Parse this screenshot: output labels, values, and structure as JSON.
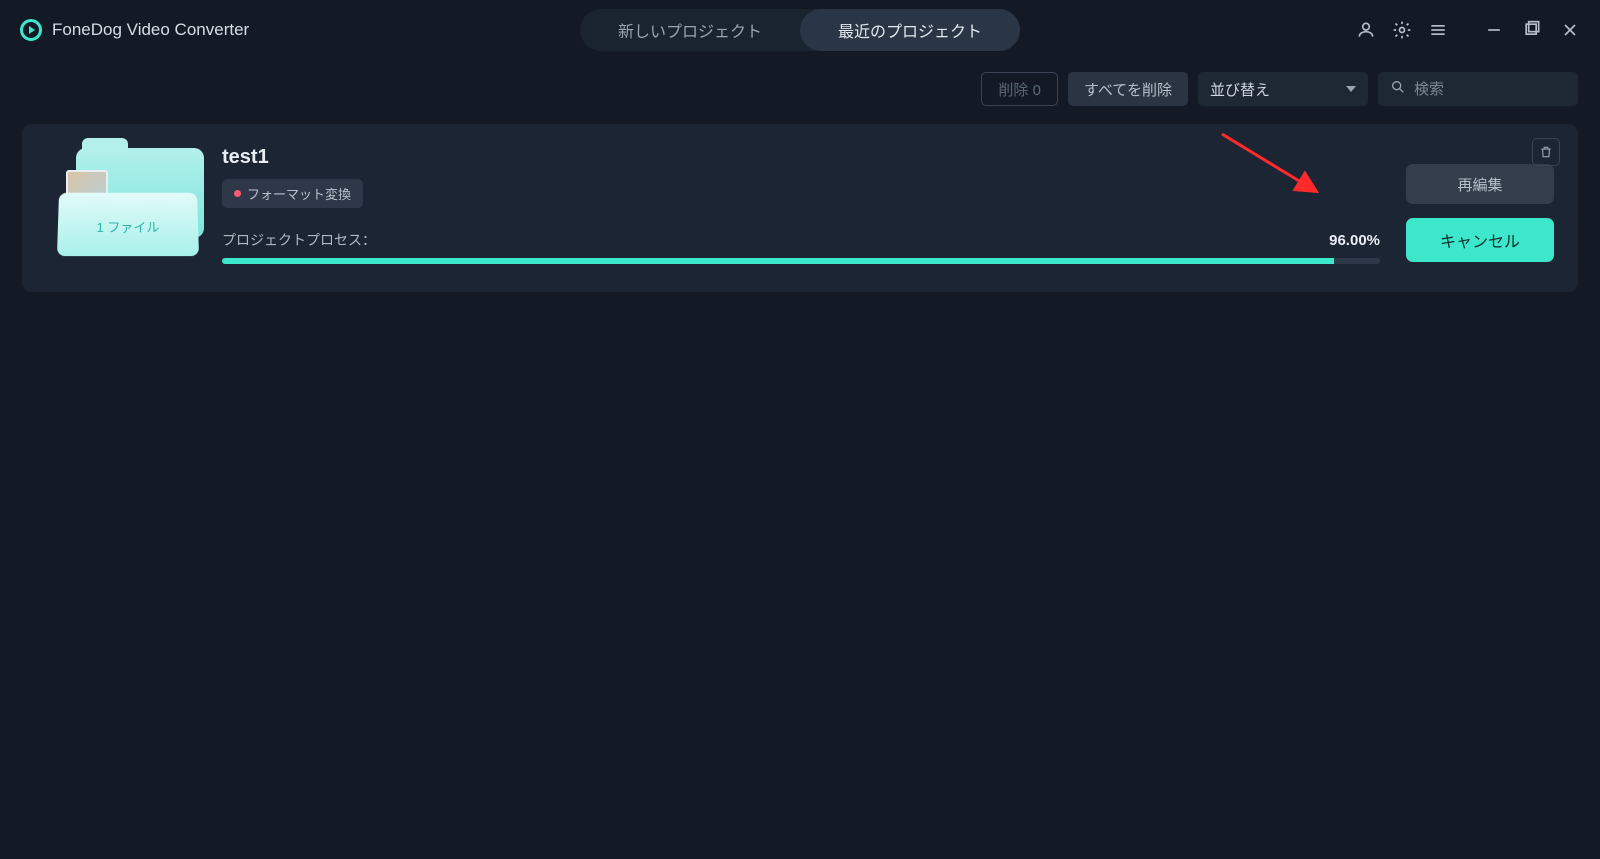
{
  "header": {
    "app_title": "FoneDog Video Converter",
    "tabs": {
      "new_project": "新しいプロジェクト",
      "recent_projects": "最近のプロジェクト"
    }
  },
  "toolbar": {
    "delete_label": "削除 0",
    "delete_all_label": "すべてを削除",
    "sort_label": "並び替え",
    "search_placeholder": "検索"
  },
  "project": {
    "name": "test1",
    "folder_label": "1 ファイル",
    "tag_label": "フォーマット変換",
    "progress_label": "プロジェクトプロセス：",
    "progress_pct_text": "96.00%",
    "progress_pct_value": 96,
    "reedit_label": "再編集",
    "cancel_label": "キャンセル"
  }
}
